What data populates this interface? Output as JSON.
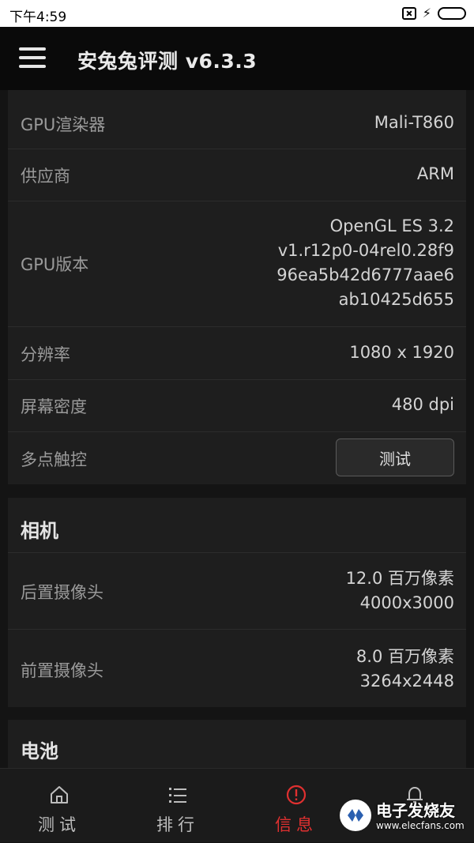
{
  "status_bar": {
    "time": "下午4:59",
    "icons": [
      "sim-off-icon",
      "charging-bolt-icon",
      "battery-icon"
    ],
    "battery_color": "#33b34a"
  },
  "app_bar": {
    "menu_icon": "hamburger-menu-icon",
    "title": "安兔兔评测 v6.3.3"
  },
  "gpu_section": {
    "rows": [
      {
        "label": "GPU渲染器",
        "value": "Mali-T860"
      },
      {
        "label": "供应商",
        "value": "ARM"
      },
      {
        "label": "GPU版本",
        "value_lines": [
          "OpenGL ES 3.2",
          "v1.r12p0-04rel0.28f9",
          "96ea5b42d6777aae6",
          "ab10425d655"
        ]
      },
      {
        "label": "分辨率",
        "value": "1080 x 1920"
      },
      {
        "label": "屏幕密度",
        "value": "480 dpi"
      },
      {
        "label": "多点触控",
        "button": "测试"
      }
    ]
  },
  "camera_section": {
    "title": "相机",
    "rows": [
      {
        "label": "后置摄像头",
        "value_lines": [
          "12.0 百万像素",
          "4000x3000"
        ]
      },
      {
        "label": "前置摄像头",
        "value_lines": [
          "8.0 百万像素",
          "3264x2448"
        ]
      }
    ]
  },
  "battery_section": {
    "title": "电池"
  },
  "bottom_nav": {
    "active_color": "#e03030",
    "items": [
      {
        "label": "测试",
        "icon": "home-icon"
      },
      {
        "label": "排行",
        "icon": "list-icon"
      },
      {
        "label": "信息",
        "icon": "info-alert-icon",
        "active": true
      },
      {
        "label": "",
        "icon": "bell-icon"
      }
    ]
  },
  "watermark": {
    "text": "电子发烧友",
    "url": "www.elecfans.com"
  }
}
